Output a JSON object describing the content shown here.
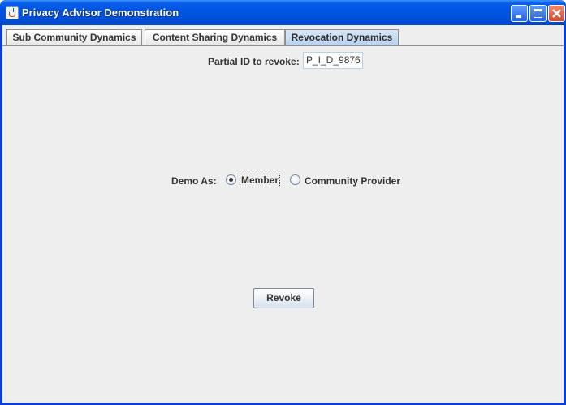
{
  "window": {
    "title": "Privacy Advisor Demonstration"
  },
  "tabs": [
    {
      "label": "Sub Community Dynamics",
      "selected": false
    },
    {
      "label": "Content Sharing Dynamics",
      "selected": false
    },
    {
      "label": "Revocation Dynamics",
      "selected": true
    }
  ],
  "revocation": {
    "partial_id_label": "Partial ID to revoke:",
    "partial_id_value": "P_I_D_9876",
    "demo_as_label": "Demo As:",
    "options": [
      {
        "label": "Member",
        "selected": true
      },
      {
        "label": "Community Provider",
        "selected": false
      }
    ],
    "revoke_button": "Revoke"
  },
  "colors": {
    "titlebar": "#0054e3",
    "panel_bg": "#eeeeee",
    "selected_tab": "#b9d1ef"
  }
}
